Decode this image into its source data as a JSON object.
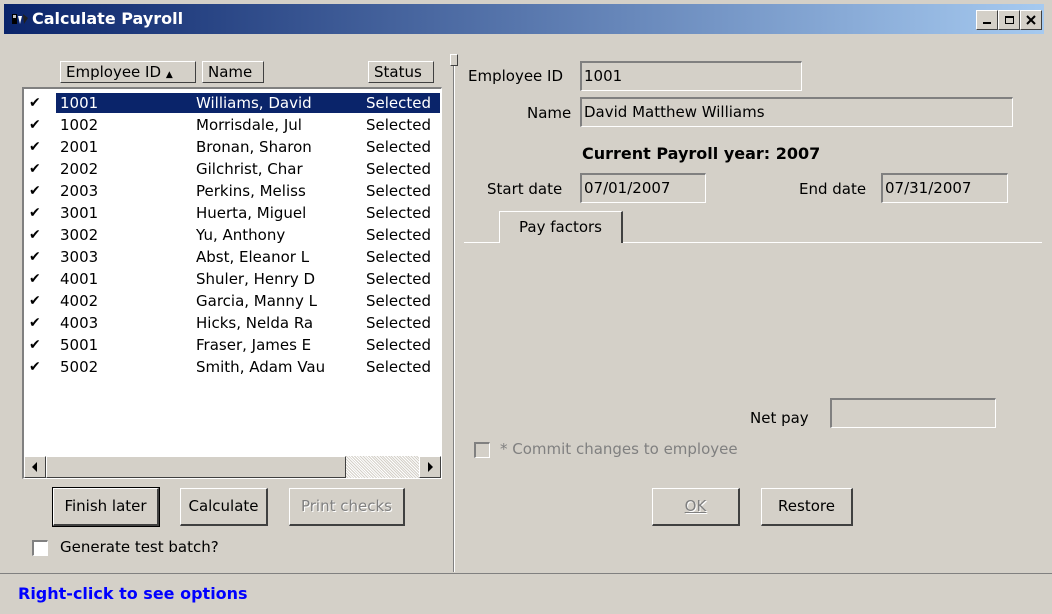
{
  "window": {
    "title": "Calculate Payroll",
    "icon": "payroll-app-icon",
    "controls": {
      "minimize": "_",
      "maximize": "□",
      "close": "×"
    }
  },
  "employee_list": {
    "columns": [
      "Employee ID",
      "Name",
      "Status"
    ],
    "sort_indicator": "▲",
    "rows": [
      {
        "checked": "✔",
        "id": "1001",
        "name": "Williams, David",
        "status": "Selected"
      },
      {
        "checked": "✔",
        "id": "1002",
        "name": "Morrisdale, Jul",
        "status": "Selected"
      },
      {
        "checked": "✔",
        "id": "2001",
        "name": "Bronan, Sharon",
        "status": "Selected"
      },
      {
        "checked": "✔",
        "id": "2002",
        "name": "Gilchrist, Char",
        "status": "Selected"
      },
      {
        "checked": "✔",
        "id": "2003",
        "name": "Perkins, Meliss",
        "status": "Selected"
      },
      {
        "checked": "✔",
        "id": "3001",
        "name": "Huerta, Miguel",
        "status": "Selected"
      },
      {
        "checked": "✔",
        "id": "3002",
        "name": "Yu, Anthony",
        "status": "Selected"
      },
      {
        "checked": "✔",
        "id": "3003",
        "name": "Abst, Eleanor L",
        "status": "Selected"
      },
      {
        "checked": "✔",
        "id": "4001",
        "name": "Shuler, Henry D",
        "status": "Selected"
      },
      {
        "checked": "✔",
        "id": "4002",
        "name": "Garcia, Manny L",
        "status": "Selected"
      },
      {
        "checked": "✔",
        "id": "4003",
        "name": "Hicks, Nelda Ra",
        "status": "Selected"
      },
      {
        "checked": "✔",
        "id": "5001",
        "name": "Fraser, James E",
        "status": "Selected"
      },
      {
        "checked": "✔",
        "id": "5002",
        "name": "Smith, Adam Vau",
        "status": "Selected"
      }
    ],
    "selected_index": 0
  },
  "left_buttons": {
    "finish_later": "Finish later",
    "calculate": "Calculate",
    "print_checks": "Print checks"
  },
  "generate_test_batch": {
    "label": "Generate test batch?",
    "checked": false
  },
  "detail": {
    "employee_id_label": "Employee ID",
    "employee_id_value": "1001",
    "name_label": "Name",
    "name_value": "David Matthew Williams",
    "payroll_year": "Current Payroll year: 2007",
    "start_date_label": "Start date",
    "start_date_value": "07/01/2007",
    "end_date_label": "End date",
    "end_date_value": "07/31/2007",
    "tab_label": "Pay factors",
    "net_pay_label": "Net pay",
    "net_pay_value": "",
    "commit_label": "* Commit changes to employee",
    "commit_checked": false,
    "ok_label": "OK",
    "restore_label": "Restore"
  },
  "status_bar": {
    "text": "Right-click to see options",
    "color": "#0000ff"
  }
}
